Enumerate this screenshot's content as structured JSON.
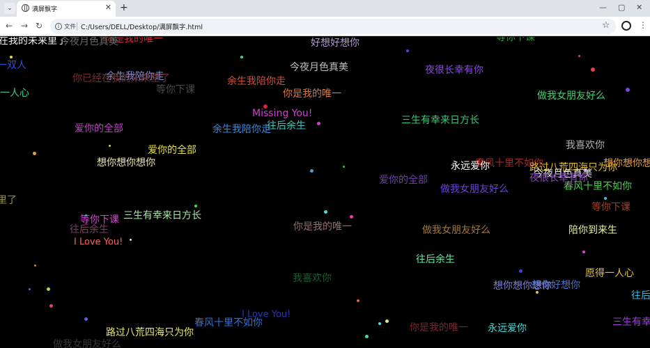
{
  "browser": {
    "tab_title": "满屏飘字",
    "new_tab": "+",
    "address_chip": "文件",
    "url": "C:/Users/DELL/Desktop/满屏飘字.html"
  },
  "words": [
    {
      "text": "在我的未来里了",
      "color": "#f2f2f2"
    },
    {
      "text": "你是我的唯一",
      "color": "#d22a3a"
    },
    {
      "text": "好想好想你",
      "color": "#b59ad0"
    },
    {
      "text": "等你下课",
      "color": "#2f9e46"
    },
    {
      "text": "一双人",
      "color": "#2c50d8"
    },
    {
      "text": "今夜月色真美",
      "color": "#6b6b6b"
    },
    {
      "text": "夜很长幸有你",
      "color": "#8a48e0"
    },
    {
      "text": "余生我陪你走",
      "color": "#8a8fd6"
    },
    {
      "text": "你已经在我的未来里了",
      "color": "#7a2f2f"
    },
    {
      "text": "余生我陪你走",
      "color": "#d44e3e"
    },
    {
      "text": "今夜月色真美",
      "color": "#bfbfbf"
    },
    {
      "text": "等你下课",
      "color": "#4a4a4a"
    },
    {
      "text": "你是我的唯一",
      "color": "#e07838"
    },
    {
      "text": "一人心",
      "color": "#3ac8a0"
    },
    {
      "text": "做我女朋友好么",
      "color": "#3fd070"
    },
    {
      "text": "Missing You!",
      "color": "#d040d0"
    },
    {
      "text": "三生有幸来日方长",
      "color": "#3ac87a"
    },
    {
      "text": "爱你的全部",
      "color": "#c040c8"
    },
    {
      "text": "余生我陪你走",
      "color": "#3a8ad8"
    },
    {
      "text": "往后余生",
      "color": "#40c8c0"
    },
    {
      "text": "我喜欢你",
      "color": "#b0b0b0"
    },
    {
      "text": "爱你的全部",
      "color": "#e8e040"
    },
    {
      "text": "想你想你想你",
      "color": "#e8e8b0"
    },
    {
      "text": "春风十里不如你",
      "color": "#a02828"
    },
    {
      "text": "永远爱你",
      "color": "#ffffff"
    },
    {
      "text": "路过八荒四海只为你",
      "color": "#e8c018"
    },
    {
      "text": "想你想你想你",
      "color": "#e0a040"
    },
    {
      "text": "今夜月色真美",
      "color": "#e8e8e8"
    },
    {
      "text": "爱你的全部",
      "color": "#7040b0"
    },
    {
      "text": "夜很长幸有你",
      "color": "#9048c8"
    },
    {
      "text": "做我女朋友好么",
      "color": "#6a40d8"
    },
    {
      "text": "春风十里不如你",
      "color": "#48d048"
    },
    {
      "text": "里了",
      "color": "#a09030"
    },
    {
      "text": "等你下课",
      "color": "#a84020"
    },
    {
      "text": "等你下课",
      "color": "#e040d8"
    },
    {
      "text": "三生有幸来日方长",
      "color": "#a8e8a8"
    },
    {
      "text": "你是我的唯一",
      "color": "#907070"
    },
    {
      "text": "做我女朋友好么",
      "color": "#a07838"
    },
    {
      "text": "陪你到来生",
      "color": "#e8f0a0"
    },
    {
      "text": "往后余生",
      "color": "#804060"
    },
    {
      "text": "I Love You!",
      "color": "#ff6050"
    },
    {
      "text": "往后余生",
      "color": "#68e8a0"
    },
    {
      "text": "我喜欢你",
      "color": "#1a5a30"
    },
    {
      "text": "愿得一人心",
      "color": "#e8c030"
    },
    {
      "text": "想你想你想你",
      "color": "#8080d0"
    },
    {
      "text": "想你好想你",
      "color": "#5070c8"
    },
    {
      "text": "往后",
      "color": "#40b8d8"
    },
    {
      "text": "I Love You!",
      "color": "#2838b8"
    },
    {
      "text": "春风十里不如你",
      "color": "#3070d8"
    },
    {
      "text": "路过八荒四海只为你",
      "color": "#e8e870"
    },
    {
      "text": "你是我的唯一",
      "color": "#802030"
    },
    {
      "text": "永远爱你",
      "color": "#48d8d0"
    },
    {
      "text": "三生有幸",
      "color": "#a040d8"
    },
    {
      "text": "做我女朋友好么",
      "color": "#383838"
    }
  ],
  "dots": [
    {
      "color": "#e04040"
    },
    {
      "color": "#4848e0"
    },
    {
      "color": "#40d0a0"
    },
    {
      "color": "#e0e040"
    },
    {
      "color": "#d040d0"
    },
    {
      "color": "#e02040"
    },
    {
      "color": "#40a0e0"
    },
    {
      "color": "#40c040"
    },
    {
      "color": "#e0a040"
    },
    {
      "color": "#8040e0"
    },
    {
      "color": "#e84848"
    },
    {
      "color": "#40e0e0"
    },
    {
      "color": "#e0e0e0"
    },
    {
      "color": "#40e040"
    },
    {
      "color": "#e040a0"
    },
    {
      "color": "#4040e0"
    },
    {
      "color": "#e08020"
    },
    {
      "color": "#20c0c0"
    },
    {
      "color": "#a0e040"
    },
    {
      "color": "#e04080"
    },
    {
      "color": "#6060e0"
    },
    {
      "color": "#e0e080"
    },
    {
      "color": "#40e0a0"
    },
    {
      "color": "#e06040"
    },
    {
      "color": "#a040e0"
    },
    {
      "color": "#40e0e0"
    },
    {
      "color": "#e0c040"
    },
    {
      "color": "#e040e0"
    },
    {
      "color": "#40c0e0"
    },
    {
      "color": "#c0e040"
    }
  ]
}
